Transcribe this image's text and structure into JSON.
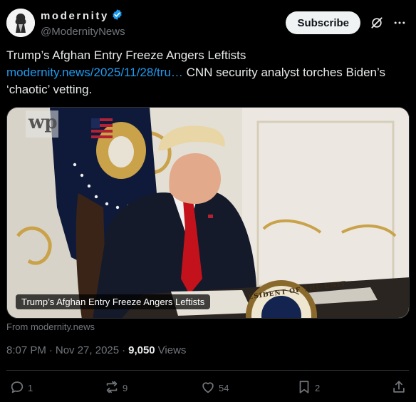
{
  "account": {
    "display_name": "modernity",
    "handle": "@ModernityNews",
    "verified_icon": "verified-badge-icon"
  },
  "header": {
    "subscribe_label": "Subscribe",
    "grok_icon": "grok-icon",
    "more_icon": "more-icon"
  },
  "tweet": {
    "line1": "Trump’s Afghan Entry Freeze Angers Leftists",
    "link_text": "modernity.news/2025/11/28/tru…",
    "line2": " CNN security analyst torches Biden’s ‘chaotic’ vetting."
  },
  "media": {
    "watermark": "wp",
    "caption": "Trump’s Afghan Entry Freeze Angers Leftists",
    "seal_text": "ESIDENT OF THE UNIT"
  },
  "card_source": "From modernity.news",
  "meta": {
    "time": "8:07 PM",
    "date": "Nov 27, 2025",
    "views_count": "9,050",
    "views_label": "Views"
  },
  "actions": {
    "replies": "1",
    "reposts": "9",
    "likes": "54",
    "bookmarks": "2"
  },
  "colors": {
    "background": "#000000",
    "text": "#e7e9ea",
    "muted": "#71767b",
    "link": "#1d9bf0",
    "verified": "#1d9bf0"
  }
}
